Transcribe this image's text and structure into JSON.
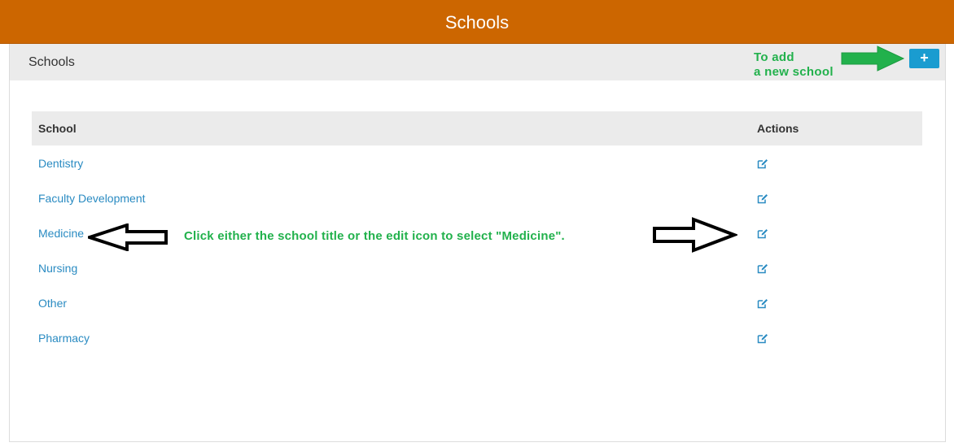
{
  "header": {
    "title": "Schools"
  },
  "panel": {
    "title": "Schools",
    "add_button_label": "+",
    "add_note_line1": "To add",
    "add_note_line2": "a new school"
  },
  "table": {
    "columns": [
      "School",
      "Actions"
    ],
    "rows": [
      {
        "school": "Dentistry"
      },
      {
        "school": "Faculty Development"
      },
      {
        "school": "Medicine"
      },
      {
        "school": "Nursing"
      },
      {
        "school": "Other"
      },
      {
        "school": "Pharmacy"
      }
    ]
  },
  "annotation": {
    "text": "Click either the school title or the edit icon to select \"Medicine\"."
  },
  "colors": {
    "header": "#cc6600",
    "link": "#2a8bc2",
    "button": "#1a9cd0",
    "annotation": "#22b14c"
  },
  "icons": {
    "edit": "edit-icon",
    "add": "plus-icon"
  }
}
